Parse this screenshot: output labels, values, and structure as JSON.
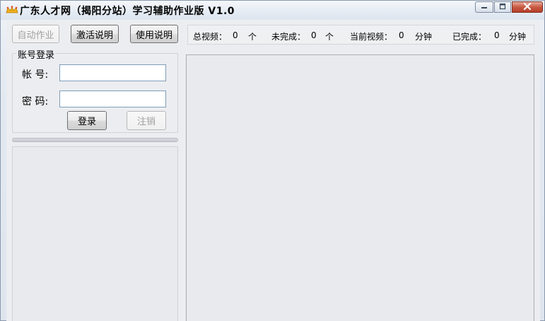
{
  "window": {
    "title": "广东人才网（揭阳分站）学习辅助作业版 V1.0"
  },
  "toolbar": {
    "auto_work_label": "自动作业",
    "activate_help_label": "激活说明",
    "usage_help_label": "使用说明"
  },
  "stats": {
    "total_videos_label": "总视频：",
    "total_videos_value": "0",
    "total_videos_unit": "个",
    "incomplete_label": "未完成：",
    "incomplete_value": "0",
    "incomplete_unit": "个",
    "current_video_label": "当前视频：",
    "current_video_value": "0",
    "current_video_unit": "分钟",
    "completed_label": "已完成：",
    "completed_value": "0",
    "completed_unit": "分钟"
  },
  "login": {
    "group_title": "账号登录",
    "account_label": "帐  号:",
    "account_value": "",
    "password_label": "密  码:",
    "password_value": "",
    "login_button": "登录",
    "logout_button": "注销"
  },
  "colors": {
    "value_blue": "#1f3aa6",
    "window_bg": "#ecedf0",
    "close_button_red": "#c85a43"
  },
  "icons": {
    "app": "crown-icon",
    "minimize": "minimize-icon",
    "maximize": "maximize-icon",
    "close": "close-icon"
  }
}
